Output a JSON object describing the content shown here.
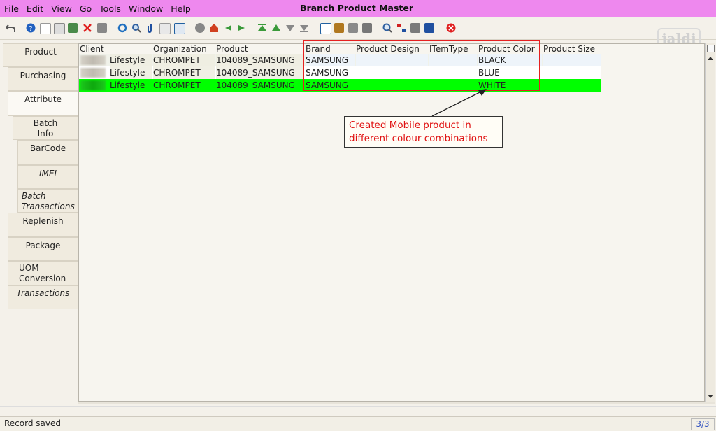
{
  "window": {
    "title": "Branch Product Master"
  },
  "menu": [
    "File",
    "Edit",
    "View",
    "Go",
    "Tools",
    "Window",
    "Help"
  ],
  "watermark": "jaldi",
  "tabs": [
    {
      "label": "Product"
    },
    {
      "label": "Purchasing"
    },
    {
      "label": "Attribute"
    },
    {
      "label": "Batch Info"
    },
    {
      "label": "BarCode"
    },
    {
      "label": "IMEI"
    },
    {
      "label": "Batch Transactions"
    },
    {
      "label": "Replenish"
    },
    {
      "label": "Package"
    },
    {
      "label": "UOM Conversion"
    },
    {
      "label": "Transactions"
    }
  ],
  "grid": {
    "columns": [
      "Client",
      "Organization",
      "Product",
      "Brand",
      "Product Design",
      "ITemType",
      "Product Color",
      "Product Size"
    ],
    "rows": [
      {
        "client": "Lifestyle",
        "organization": "CHROMPET",
        "product": "104089_SAMSUNG",
        "brand": "SAMSUNG",
        "design": "",
        "itemtype": "",
        "color": "BLACK",
        "size": ""
      },
      {
        "client": "Lifestyle",
        "organization": "CHROMPET",
        "product": "104089_SAMSUNG",
        "brand": "SAMSUNG",
        "design": "",
        "itemtype": "",
        "color": "BLUE",
        "size": ""
      },
      {
        "client": "Lifestyle",
        "organization": "CHROMPET",
        "product": "104089_SAMSUNG",
        "brand": "SAMSUNG",
        "design": "",
        "itemtype": "",
        "color": "WHITE",
        "size": ""
      }
    ],
    "selected_row_color": "#00ff00"
  },
  "annotation": {
    "line1": "Created Mobile product in",
    "line2": "different colour combinations",
    "color": "#e62020"
  },
  "status": {
    "message": "Record saved",
    "record_count": "3/3"
  }
}
